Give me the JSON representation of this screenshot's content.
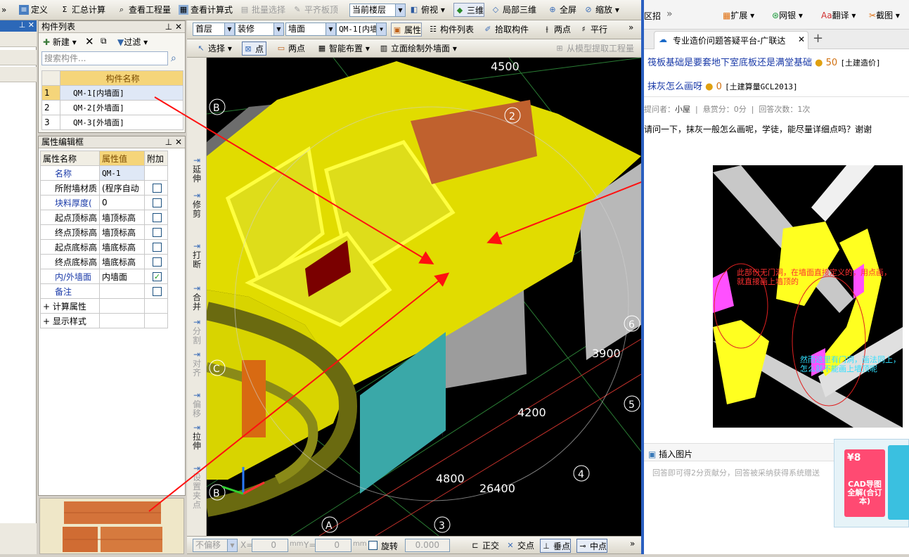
{
  "toolbar_main": {
    "items": [
      {
        "label": "定义",
        "icon": "define-icon"
      },
      {
        "label": "汇总计算",
        "icon": "sigma-icon"
      },
      {
        "label": "查看工程量",
        "icon": "view-quantity-icon"
      },
      {
        "label": "查看计算式",
        "icon": "formula-icon"
      },
      {
        "label": "批量选择",
        "icon": "batch-select-icon"
      },
      {
        "label": "平齐板顶",
        "icon": "flush-icon"
      }
    ],
    "floor_select": "当前楼层",
    "view_items": [
      {
        "label": "俯视",
        "icon": "top-view-icon"
      },
      {
        "label": "三维",
        "icon": "3d-icon"
      },
      {
        "label": "局部三维",
        "icon": "partial-3d-icon"
      },
      {
        "label": "全屏",
        "icon": "fullscreen-icon"
      },
      {
        "label": "缩放",
        "icon": "zoom-icon"
      }
    ]
  },
  "component_list": {
    "title": "构件列表",
    "new_label": "新建",
    "filter_label": "过滤",
    "search_placeholder": "搜索构件...",
    "col_header": "构件名称",
    "rows": [
      {
        "idx": "1",
        "name": "QM-1[内墙面]"
      },
      {
        "idx": "2",
        "name": "QM-2[外墙面]"
      },
      {
        "idx": "3",
        "name": "QM-3[外墙面]"
      }
    ]
  },
  "property_panel": {
    "title": "属性编辑框",
    "headers": [
      "属性名称",
      "属性值",
      "附加"
    ],
    "rows": [
      {
        "name": "名称",
        "value": "QM-1",
        "blue": true,
        "check": ""
      },
      {
        "name": "所附墙材质",
        "value": "(程序自动",
        "blue": false,
        "check": "empty"
      },
      {
        "name": "块料厚度(",
        "value": "0",
        "blue": true,
        "check": "empty"
      },
      {
        "name": "起点顶标高",
        "value": "墙顶标高",
        "blue": false,
        "check": "empty"
      },
      {
        "name": "终点顶标高",
        "value": "墙顶标高",
        "blue": false,
        "check": "empty"
      },
      {
        "name": "起点底标高",
        "value": "墙底标高",
        "blue": false,
        "check": "empty"
      },
      {
        "name": "终点底标高",
        "value": "墙底标高",
        "blue": false,
        "check": "empty"
      },
      {
        "name": "内/外墙面",
        "value": "内墙面",
        "blue": true,
        "check": "checked"
      },
      {
        "name": "备注",
        "value": "",
        "blue": true,
        "check": "empty"
      }
    ],
    "groups": [
      "计算属性",
      "显示样式"
    ]
  },
  "layer_bar": {
    "floor": "首层",
    "category": "装修",
    "type": "墙面",
    "component": "QM-1[内墙",
    "btn_props": "属性",
    "btn_list": "构件列表",
    "btn_pick": "拾取构件",
    "btn_two": "两点",
    "btn_parallel": "平行"
  },
  "draw_bar": {
    "select": "选择",
    "point": "点",
    "two_point": "两点",
    "smart": "智能布置",
    "elevation": "立面绘制外墙面",
    "extract": "从模型提取工程量"
  },
  "vertical_tools": [
    "延伸",
    "修剪",
    "打断",
    "合并",
    "分割",
    "对齐",
    "偏移",
    "拉伸",
    "设置夹点"
  ],
  "status_bar": {
    "offset": "不偏移",
    "x_label": "X=",
    "x_val": "0",
    "y_label": "Y=",
    "y_val": "0",
    "unit": "mm",
    "rotate": "旋转",
    "rotate_val": "0.000",
    "snaps": [
      "正交",
      "交点",
      "垂点",
      "中点"
    ]
  },
  "viewport": {
    "dims": [
      "4500",
      "3900",
      "4200",
      "4800",
      "26400"
    ],
    "axes": [
      "B",
      "C",
      "B",
      "A",
      "2",
      "6",
      "5",
      "4",
      "3"
    ]
  },
  "browser": {
    "tab_hint": "区招",
    "toolbar": [
      "扩展",
      "网银",
      "翻译",
      "截图"
    ],
    "tab_title": "专业造价问题答疑平台-广联达",
    "related": [
      {
        "title": "筏板基础是要套地下室底板还是满堂基础",
        "coins": "50",
        "tag": "[土建造价]"
      },
      {
        "title": "抹灰怎么画呀",
        "coins": "0",
        "tag": "[土建算量GCL2013]"
      }
    ],
    "meta": {
      "asker_label": "提问者：",
      "asker": "小屋",
      "reward": "悬赏分：0分",
      "answers": "回答次数：1次"
    },
    "question": "请问一下，抹灰一般怎么画呢，学徒，能尽量详细点吗？谢谢",
    "annotation1": "此部份无门洞，在墙面直接定义的，用点画，就直接画上墙顶的",
    "annotation2": "然而这里有门洞，画法同上，怎么就不能画上墙顶呢",
    "insert_image": "插入图片",
    "answer_placeholder": "回答即可得2分贡献分，回答被采纳获得系统赠送",
    "ad_text": "CAD导图全解(合订本)",
    "ad_badge": "¥8"
  }
}
